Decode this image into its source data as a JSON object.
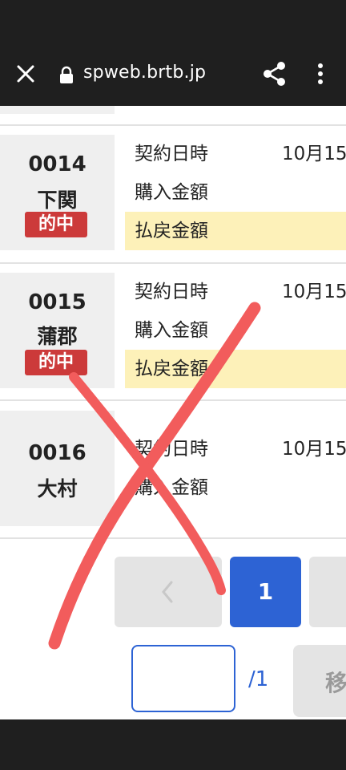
{
  "browser": {
    "url": "spweb.brtb.jp",
    "icons": [
      "close-icon",
      "lock-icon",
      "share-icon",
      "more-vert-icon"
    ]
  },
  "races": [
    {
      "number": "0014",
      "place": "下関",
      "badge": "的中",
      "rows": [
        {
          "label": "契約日時",
          "value": "10月15"
        },
        {
          "label": "購入金額",
          "value": ""
        },
        {
          "label": "払戻金額",
          "value": ""
        }
      ]
    },
    {
      "number": "0015",
      "place": "蒲郡",
      "badge": "的中",
      "rows": [
        {
          "label": "契約日時",
          "value": "10月15"
        },
        {
          "label": "購入金額",
          "value": ""
        },
        {
          "label": "払戻金額",
          "value": ""
        }
      ]
    },
    {
      "number": "0016",
      "place": "大村",
      "badge": "",
      "rows": [
        {
          "label": "契約日時",
          "value": "10月15"
        },
        {
          "label": "購入金額",
          "value": ""
        }
      ]
    }
  ],
  "pagination": {
    "current_page": "1",
    "total": "/1",
    "page_input_value": "",
    "move_label": "移"
  },
  "colors": {
    "accent_blue": "#2d63d4",
    "hit_badge": "#cc3a3a",
    "payout_highlight": "#fdf1b9",
    "overlay_stroke": "#f25c5c"
  }
}
